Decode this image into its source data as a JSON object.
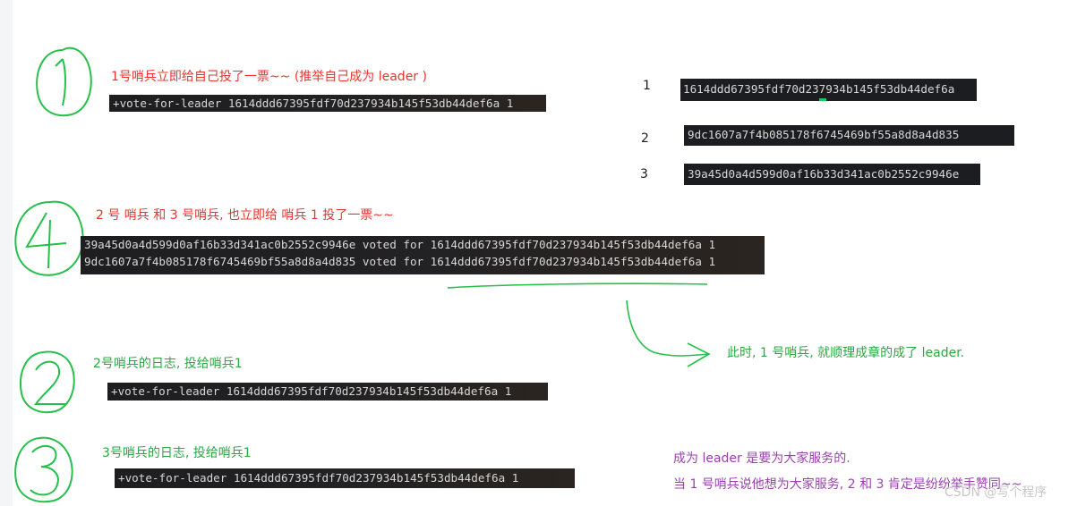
{
  "step1": {
    "annotation": "1号哨兵立即给自己投了一票~~ (推举自己成为 leader )",
    "log": "+vote-for-leader 1614ddd67395fdf70d237934b145f53db44def6a 1"
  },
  "ids": [
    {
      "label": "1",
      "value": "1614ddd67395fdf70d237934b145f53db44def6a"
    },
    {
      "label": "2",
      "value": "9dc1607a7f4b085178f6745469bf55a8d8a4d835"
    },
    {
      "label": "3",
      "value": "39a45d0a4d599d0af16b33d341ac0b2552c9946e"
    }
  ],
  "step4": {
    "annotation": "2 号 哨兵 和  3 号哨兵, 也立即给 哨兵 1 投了一票~~",
    "logs": [
      "39a45d0a4d599d0af16b33d341ac0b2552c9946e voted for 1614ddd67395fdf70d237934b145f53db44def6a 1",
      "9dc1607a7f4b085178f6745469bf55a8d8a4d835 voted for 1614ddd67395fdf70d237934b145f53db44def6a 1"
    ]
  },
  "conclusion": "此时, 1 号哨兵, 就顺理成章的成了 leader.",
  "step2": {
    "annotation": "2号哨兵的日志, 投给哨兵1",
    "log": "+vote-for-leader 1614ddd67395fdf70d237934b145f53db44def6a 1"
  },
  "step3": {
    "annotation": "3号哨兵的日志, 投给哨兵1",
    "log": "+vote-for-leader 1614ddd67395fdf70d237934b145f53db44def6a 1"
  },
  "footer": {
    "line1": "成为 leader 是要为大家服务的.",
    "line2": "当 1 号哨兵说他想为大家服务, 2 和 3 肯定是纷纷举手赞同~~"
  },
  "watermark": "CSDN @写个程序",
  "colors": {
    "red": "#e8342f",
    "green": "#2aa844",
    "purple": "#9c3fb0",
    "terminal": "#1c1d21"
  }
}
